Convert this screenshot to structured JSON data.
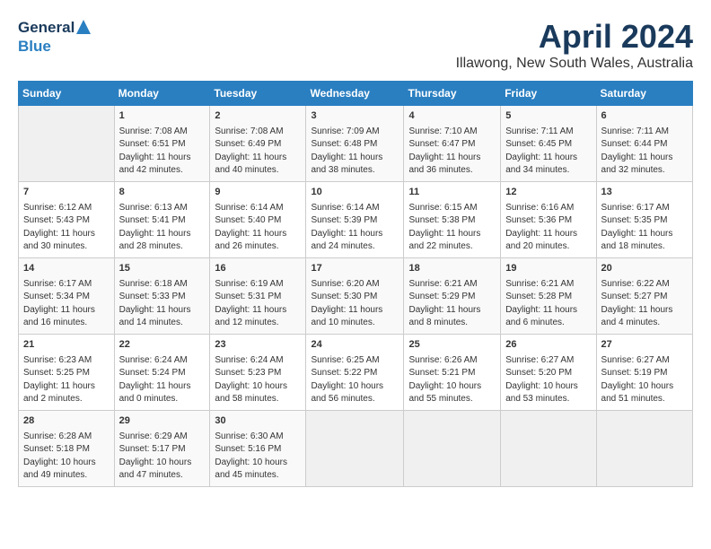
{
  "logo": {
    "general": "General",
    "blue": "Blue"
  },
  "title": {
    "month_year": "April 2024",
    "location": "Illawong, New South Wales, Australia"
  },
  "weekdays": [
    "Sunday",
    "Monday",
    "Tuesday",
    "Wednesday",
    "Thursday",
    "Friday",
    "Saturday"
  ],
  "weeks": [
    [
      {
        "day": "",
        "content": ""
      },
      {
        "day": "1",
        "content": "Sunrise: 7:08 AM\nSunset: 6:51 PM\nDaylight: 11 hours\nand 42 minutes."
      },
      {
        "day": "2",
        "content": "Sunrise: 7:08 AM\nSunset: 6:49 PM\nDaylight: 11 hours\nand 40 minutes."
      },
      {
        "day": "3",
        "content": "Sunrise: 7:09 AM\nSunset: 6:48 PM\nDaylight: 11 hours\nand 38 minutes."
      },
      {
        "day": "4",
        "content": "Sunrise: 7:10 AM\nSunset: 6:47 PM\nDaylight: 11 hours\nand 36 minutes."
      },
      {
        "day": "5",
        "content": "Sunrise: 7:11 AM\nSunset: 6:45 PM\nDaylight: 11 hours\nand 34 minutes."
      },
      {
        "day": "6",
        "content": "Sunrise: 7:11 AM\nSunset: 6:44 PM\nDaylight: 11 hours\nand 32 minutes."
      }
    ],
    [
      {
        "day": "7",
        "content": "Sunrise: 6:12 AM\nSunset: 5:43 PM\nDaylight: 11 hours\nand 30 minutes."
      },
      {
        "day": "8",
        "content": "Sunrise: 6:13 AM\nSunset: 5:41 PM\nDaylight: 11 hours\nand 28 minutes."
      },
      {
        "day": "9",
        "content": "Sunrise: 6:14 AM\nSunset: 5:40 PM\nDaylight: 11 hours\nand 26 minutes."
      },
      {
        "day": "10",
        "content": "Sunrise: 6:14 AM\nSunset: 5:39 PM\nDaylight: 11 hours\nand 24 minutes."
      },
      {
        "day": "11",
        "content": "Sunrise: 6:15 AM\nSunset: 5:38 PM\nDaylight: 11 hours\nand 22 minutes."
      },
      {
        "day": "12",
        "content": "Sunrise: 6:16 AM\nSunset: 5:36 PM\nDaylight: 11 hours\nand 20 minutes."
      },
      {
        "day": "13",
        "content": "Sunrise: 6:17 AM\nSunset: 5:35 PM\nDaylight: 11 hours\nand 18 minutes."
      }
    ],
    [
      {
        "day": "14",
        "content": "Sunrise: 6:17 AM\nSunset: 5:34 PM\nDaylight: 11 hours\nand 16 minutes."
      },
      {
        "day": "15",
        "content": "Sunrise: 6:18 AM\nSunset: 5:33 PM\nDaylight: 11 hours\nand 14 minutes."
      },
      {
        "day": "16",
        "content": "Sunrise: 6:19 AM\nSunset: 5:31 PM\nDaylight: 11 hours\nand 12 minutes."
      },
      {
        "day": "17",
        "content": "Sunrise: 6:20 AM\nSunset: 5:30 PM\nDaylight: 11 hours\nand 10 minutes."
      },
      {
        "day": "18",
        "content": "Sunrise: 6:21 AM\nSunset: 5:29 PM\nDaylight: 11 hours\nand 8 minutes."
      },
      {
        "day": "19",
        "content": "Sunrise: 6:21 AM\nSunset: 5:28 PM\nDaylight: 11 hours\nand 6 minutes."
      },
      {
        "day": "20",
        "content": "Sunrise: 6:22 AM\nSunset: 5:27 PM\nDaylight: 11 hours\nand 4 minutes."
      }
    ],
    [
      {
        "day": "21",
        "content": "Sunrise: 6:23 AM\nSunset: 5:25 PM\nDaylight: 11 hours\nand 2 minutes."
      },
      {
        "day": "22",
        "content": "Sunrise: 6:24 AM\nSunset: 5:24 PM\nDaylight: 11 hours\nand 0 minutes."
      },
      {
        "day": "23",
        "content": "Sunrise: 6:24 AM\nSunset: 5:23 PM\nDaylight: 10 hours\nand 58 minutes."
      },
      {
        "day": "24",
        "content": "Sunrise: 6:25 AM\nSunset: 5:22 PM\nDaylight: 10 hours\nand 56 minutes."
      },
      {
        "day": "25",
        "content": "Sunrise: 6:26 AM\nSunset: 5:21 PM\nDaylight: 10 hours\nand 55 minutes."
      },
      {
        "day": "26",
        "content": "Sunrise: 6:27 AM\nSunset: 5:20 PM\nDaylight: 10 hours\nand 53 minutes."
      },
      {
        "day": "27",
        "content": "Sunrise: 6:27 AM\nSunset: 5:19 PM\nDaylight: 10 hours\nand 51 minutes."
      }
    ],
    [
      {
        "day": "28",
        "content": "Sunrise: 6:28 AM\nSunset: 5:18 PM\nDaylight: 10 hours\nand 49 minutes."
      },
      {
        "day": "29",
        "content": "Sunrise: 6:29 AM\nSunset: 5:17 PM\nDaylight: 10 hours\nand 47 minutes."
      },
      {
        "day": "30",
        "content": "Sunrise: 6:30 AM\nSunset: 5:16 PM\nDaylight: 10 hours\nand 45 minutes."
      },
      {
        "day": "",
        "content": ""
      },
      {
        "day": "",
        "content": ""
      },
      {
        "day": "",
        "content": ""
      },
      {
        "day": "",
        "content": ""
      }
    ]
  ]
}
